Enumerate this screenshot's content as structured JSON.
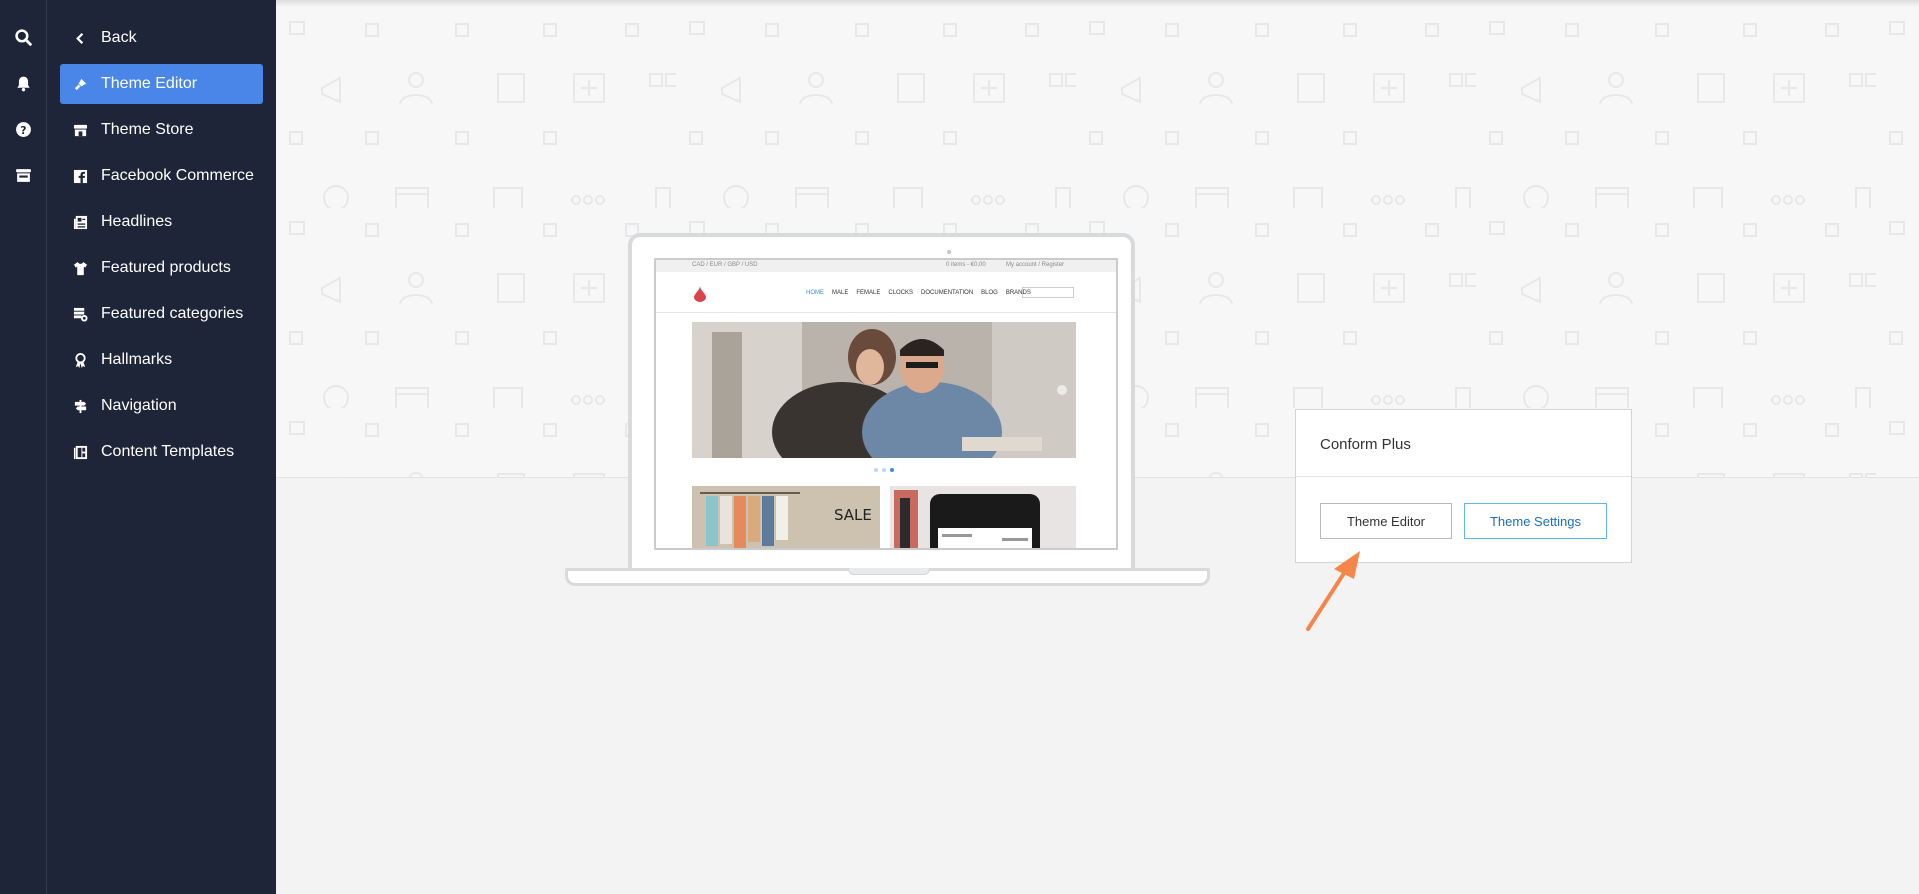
{
  "rail": {
    "icons": [
      "search-icon",
      "bell-icon",
      "help-icon",
      "store-icon"
    ]
  },
  "sidebar": {
    "back_label": "Back",
    "items": [
      {
        "label": "Theme Editor",
        "icon": "brush-icon",
        "active": true
      },
      {
        "label": "Theme Store",
        "icon": "store-icon",
        "active": false
      },
      {
        "label": "Facebook Commerce",
        "icon": "facebook-icon",
        "active": false
      },
      {
        "label": "Headlines",
        "icon": "newspaper-icon",
        "active": false
      },
      {
        "label": "Featured products",
        "icon": "tshirt-icon",
        "active": false
      },
      {
        "label": "Featured categories",
        "icon": "categories-icon",
        "active": false
      },
      {
        "label": "Hallmarks",
        "icon": "award-icon",
        "active": false
      },
      {
        "label": "Navigation",
        "icon": "signpost-icon",
        "active": false
      },
      {
        "label": "Content Templates",
        "icon": "template-icon",
        "active": false
      }
    ]
  },
  "preview": {
    "site_topbar_left": "CAD / EUR / GBP / USD",
    "site_topbar_cart": "0 items - €0,00",
    "site_topbar_account": "My account / Register",
    "site_nav": [
      "HOME",
      "MALE",
      "FEMALE",
      "CLOCKS",
      "DOCUMENTATION",
      "BLOG",
      "BRANDS"
    ],
    "sale_label": "SALE"
  },
  "theme_card": {
    "title": "Conform Plus",
    "editor_button": "Theme Editor",
    "settings_button": "Theme Settings"
  },
  "colors": {
    "sidebar_bg": "#1e2538",
    "active_item": "#4a86e8",
    "accent_arrow": "#f58549",
    "settings_border": "#5fb8e8",
    "settings_text": "#1a6fc4"
  }
}
